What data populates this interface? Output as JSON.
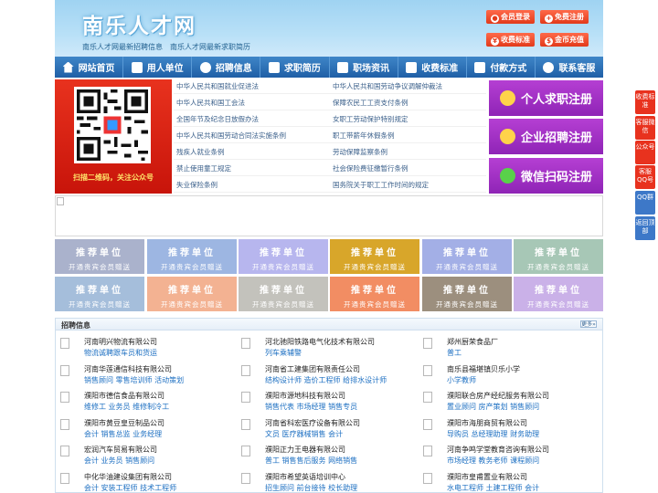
{
  "header": {
    "logo": "南乐人才网",
    "slogan": "南乐人才网最新招聘信息　南乐人才网最新求职简历",
    "buttons": [
      {
        "label": "会员登录",
        "icon": "user-icon"
      },
      {
        "label": "免费注册",
        "icon": "user-add-icon"
      },
      {
        "label": "收费标准",
        "icon": "yen-icon"
      },
      {
        "label": "金币充值",
        "icon": "coin-icon"
      }
    ]
  },
  "nav": [
    {
      "label": "网站首页",
      "icon": "home-icon"
    },
    {
      "label": "用人单位",
      "icon": "building-icon"
    },
    {
      "label": "招聘信息",
      "icon": "recruit-icon"
    },
    {
      "label": "求职简历",
      "icon": "resume-icon"
    },
    {
      "label": "职场资讯",
      "icon": "news-icon"
    },
    {
      "label": "收费标准",
      "icon": "price-icon"
    },
    {
      "label": "付款方式",
      "icon": "card-icon"
    },
    {
      "label": "联系客服",
      "icon": "phone-icon"
    }
  ],
  "qr": {
    "caption": "扫描二维码，关注公众号"
  },
  "laws": {
    "left": [
      "中华人民共和国就业促进法",
      "中华人民共和国工会法",
      "全国年节及纪念日放假办法",
      "中华人民共和国劳动合同法实施条例",
      "残疾人就业条例",
      "禁止使用童工规定",
      "失业保险条例"
    ],
    "right": [
      "中华人民共和国劳动争议调解仲裁法",
      "保障农民工工资支付条例",
      "女职工劳动保护特别规定",
      "职工带薪年休假条例",
      "劳动保障监察条例",
      "社会保险费征缴暂行条例",
      "国务院关于职工工作时间的规定"
    ]
  },
  "register": [
    {
      "label": "个人求职注册",
      "icon": "person-icon"
    },
    {
      "label": "企业招聘注册",
      "icon": "company-icon"
    },
    {
      "label": "微信扫码注册",
      "icon": "wechat-icon"
    }
  ],
  "recommend": {
    "title": "推荐单位",
    "sub": "开通贵宾会员赠送",
    "colors": [
      "#aab2cc",
      "#9db6e2",
      "#b7b6ee",
      "#d8a62a",
      "#a3afe6",
      "#a7c7b6",
      "#a5bedb",
      "#f3b292",
      "#c3c2bc",
      "#f28d63",
      "#9c8f7e",
      "#cab1e8"
    ]
  },
  "jobs": {
    "title": "招聘信息",
    "more": "更多»",
    "columns": [
      [
        {
          "name": "河南明兴物流有限公司",
          "jobs": "物流诚聘跟车员和货运"
        },
        {
          "name": "河南华莲通信科技有限公司",
          "jobs": "销售顾问 零售培训师 活动策划"
        },
        {
          "name": "濮阳市德信食品有限公司",
          "jobs": "维修工 业务员 维修制冷工"
        },
        {
          "name": "濮阳市黄豆皇豆制品公司",
          "jobs": "会计 销售总监 业务经理"
        },
        {
          "name": "宏润汽车贸易有限公司",
          "jobs": "会计 业务员 销售顾问"
        },
        {
          "name": "中化华油建设集团有限公司",
          "jobs": "会计 安装工程师 技术工程师"
        }
      ],
      [
        {
          "name": "河北驰阳铁路电气化技术有限公司",
          "jobs": "列车乘辅警"
        },
        {
          "name": "河南省工建集团有限责任公司",
          "jobs": "结构设计师 造价工程师 给排水设计师"
        },
        {
          "name": "濮阳市源地科技有限公司",
          "jobs": "销售代表 市场经理 销售专员"
        },
        {
          "name": "河南省科宏医疗设备有限公司",
          "jobs": "文员 医疗器械销售 会计"
        },
        {
          "name": "濮阳正力王电器有限公司",
          "jobs": "普工 销售售后服务 网络销售"
        },
        {
          "name": "濮阳市希望英语培训中心",
          "jobs": "招生顾问 前台接待 校长助理"
        }
      ],
      [
        {
          "name": "郑州厨荣食品厂",
          "jobs": "普工"
        },
        {
          "name": "南乐县福堪镇贝乐小学",
          "jobs": "小学教师"
        },
        {
          "name": "濮阳联合房产经纪服务有限公司",
          "jobs": "置业顾问 房产策划 销售顾问"
        },
        {
          "name": "濮阳市海朋商贸有限公司",
          "jobs": "导购员 总经理助理 财务助理"
        },
        {
          "name": "河南争鸣学堂教育咨询有限公司",
          "jobs": "市场经理 教务老师 课程顾问"
        },
        {
          "name": "濮阳市皇甫置业有限公司",
          "jobs": "水电工程师 土建工程师 会计"
        }
      ]
    ]
  },
  "float": [
    "收费标准",
    "客服微信",
    "公众号",
    "客服QQ号",
    "QQ群",
    "返回顶部"
  ]
}
